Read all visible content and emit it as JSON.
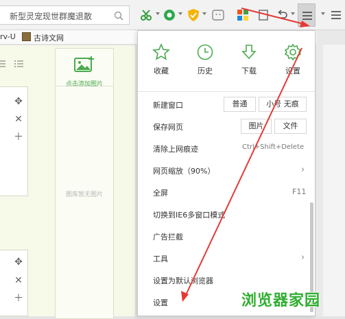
{
  "browser": {
    "address_text": "新型灵宠现世群魔退散",
    "bookmarks": [
      {
        "label": "rv-U"
      },
      {
        "label": "古诗文网"
      }
    ]
  },
  "page": {
    "gallery_add_label": "点击添加图片",
    "gallery_empty_label": "图库暂无图片",
    "panel_controls": [
      "move-icon",
      "close-icon",
      "plus-icon"
    ]
  },
  "menu": {
    "quick_actions": [
      {
        "icon": "star-icon",
        "label": "收藏"
      },
      {
        "icon": "clock-icon",
        "label": "历史"
      },
      {
        "icon": "download-icon",
        "label": "下载"
      },
      {
        "icon": "gear-icon",
        "label": "设置"
      }
    ],
    "items": [
      {
        "label": "新建窗口",
        "buttons": [
          "普通",
          "小号 无痕"
        ]
      },
      {
        "label": "保存网页",
        "buttons": [
          "图片",
          "文件"
        ]
      },
      {
        "label": "清除上网痕迹",
        "shortcut": "Ctrl+Shift+Delete"
      },
      {
        "label": "网页缩放（90%）",
        "submenu": true
      },
      {
        "label": "全屏",
        "shortcut": "F11"
      },
      {
        "label": "切换到IE6多窗口模式"
      },
      {
        "label": "广告拦截"
      },
      {
        "label": "工具",
        "submenu": true
      },
      {
        "label": "设置为默认浏览器"
      },
      {
        "label": "设置"
      }
    ]
  },
  "watermark": "浏览器家园",
  "colors": {
    "accent_green": "#4aaa4f",
    "annotation_red": "#e53935",
    "watermark_green": "#2fae2f"
  }
}
